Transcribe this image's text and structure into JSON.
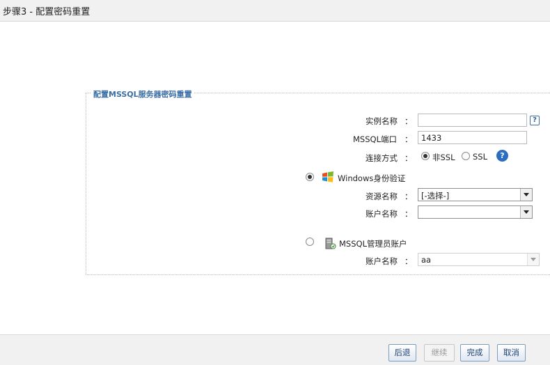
{
  "header": {
    "title": "步骤3 - 配置密码重置"
  },
  "form": {
    "legend": "配置MSSQL服务器密码重置",
    "colon": "：",
    "instance_name": {
      "label": "实例名称",
      "value": ""
    },
    "port": {
      "label": "MSSQL端口",
      "value": "1433"
    },
    "connection": {
      "label": "连接方式",
      "options": [
        {
          "label": "非SSL",
          "checked": true
        },
        {
          "label": "SSL",
          "checked": false
        }
      ]
    },
    "windows_auth": {
      "label": "Windows身份验证",
      "checked": true,
      "icon": "windows-icon",
      "resource": {
        "label": "资源名称",
        "selected": "[-选择-]"
      },
      "account": {
        "label": "账户名称",
        "selected": ""
      }
    },
    "mssql_admin": {
      "label": "MSSQL管理员账户",
      "checked": false,
      "icon": "server-icon",
      "account": {
        "label": "账户名称",
        "selected": "aa"
      }
    },
    "help_glyph": "?"
  },
  "footer": {
    "back": "后退",
    "continue": "继续",
    "finish": "完成",
    "cancel": "取消"
  },
  "colors": {
    "accent": "#3a6ea5",
    "help": "#2c6fc2"
  }
}
